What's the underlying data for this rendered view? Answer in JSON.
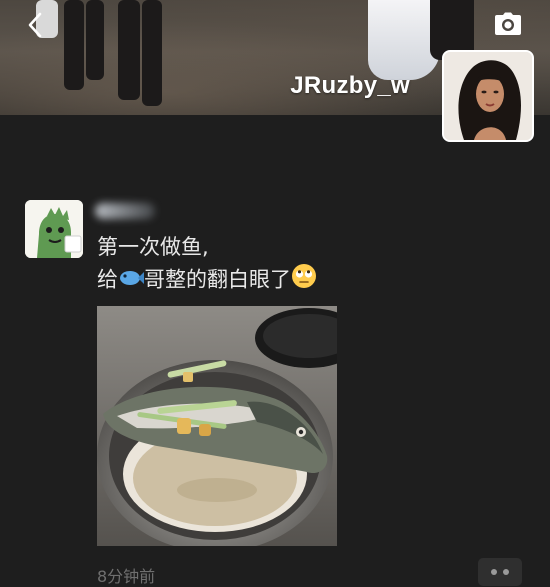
{
  "profile": {
    "username": "JRuzby_w"
  },
  "header": {
    "back_icon": "chevron-left-icon",
    "camera_icon": "camera-icon"
  },
  "post": {
    "text_line1": "第一次做鱼,",
    "text_line2_prefix": "给",
    "text_line2_suffix": "哥整的翻白眼了",
    "fish_emoji": "🐟",
    "eye_roll_emoji": "🙄",
    "timestamp": "8分钟前",
    "more_icon": "more-dots-icon"
  },
  "colors": {
    "background": "#1e1e1e",
    "username_text": "#ffffff",
    "post_text": "#e8e8e8",
    "timestamp_text": "#6f6f6f"
  }
}
